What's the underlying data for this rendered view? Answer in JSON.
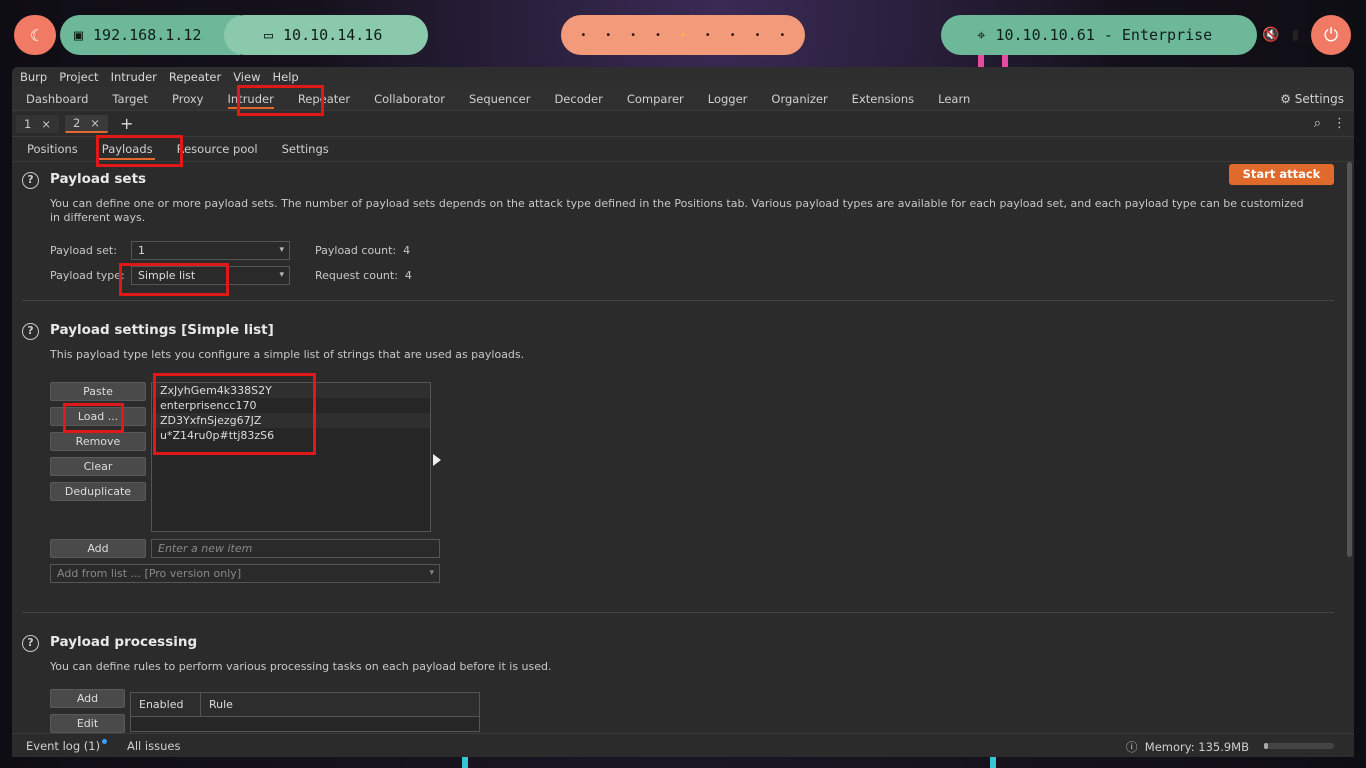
{
  "desktop": {
    "kali_icon": "kali-dragon-icon",
    "lan_ip": "192.168.1.12",
    "vpn_ip": "10.10.14.16",
    "workspaces": [
      "•",
      "•",
      "•",
      "•",
      "•",
      "•",
      "•",
      "•",
      "•"
    ],
    "active_workspace": 4,
    "target": "10.10.10.61 - Enterprise",
    "target_icon": "crosshair-icon"
  },
  "menubar": [
    "Burp",
    "Project",
    "Intruder",
    "Repeater",
    "View",
    "Help"
  ],
  "toptabs": {
    "items": [
      "Dashboard",
      "Target",
      "Proxy",
      "Intruder",
      "Repeater",
      "Collaborator",
      "Sequencer",
      "Decoder",
      "Comparer",
      "Logger",
      "Organizer",
      "Extensions",
      "Learn"
    ],
    "active": "Intruder",
    "settings_label": "Settings"
  },
  "attack_tabs": [
    {
      "label": "1",
      "close": "×"
    },
    {
      "label": "2",
      "close": "×"
    }
  ],
  "attack_tabs_add": "+",
  "section_tabs": [
    "Positions",
    "Payloads",
    "Resource pool",
    "Settings"
  ],
  "section_tabs_active": "Payloads",
  "payload_sets": {
    "title": "Payload sets",
    "start_attack": "Start attack",
    "description": "You can define one or more payload sets. The number of payload sets depends on the attack type defined in the Positions tab. Various payload types are available for each payload set, and each payload type can be customized in different ways.",
    "payload_set_label": "Payload set:",
    "payload_set_value": "1",
    "payload_type_label": "Payload type:",
    "payload_type_value": "Simple list",
    "payload_count_label": "Payload count:",
    "payload_count": "4",
    "request_count_label": "Request count:",
    "request_count": "4"
  },
  "payload_settings": {
    "title": "Payload settings [Simple list]",
    "description": "This payload type lets you configure a simple list of strings that are used as payloads.",
    "buttons": {
      "paste": "Paste",
      "load": "Load ...",
      "remove": "Remove",
      "clear": "Clear",
      "deduplicate": "Deduplicate",
      "add": "Add"
    },
    "items": [
      "ZxJyhGem4k338S2Y",
      "enterprisencc170",
      "ZD3YxfnSjezg67JZ",
      "u*Z14ru0p#ttj83zS6"
    ],
    "new_item_placeholder": "Enter a new item",
    "add_from_list": "Add from list ... [Pro version only]"
  },
  "payload_processing": {
    "title": "Payload processing",
    "description": "You can define rules to perform various processing tasks on each payload before it is used.",
    "add": "Add",
    "edit": "Edit",
    "columns": [
      "Enabled",
      "Rule"
    ]
  },
  "statusbar": {
    "event_log": "Event log (1)",
    "all_issues": "All issues",
    "memory": "Memory: 135.9MB",
    "memory_fraction": 0.06
  },
  "colors": {
    "accent": "#e06a2b",
    "highlight": "#e01818"
  }
}
